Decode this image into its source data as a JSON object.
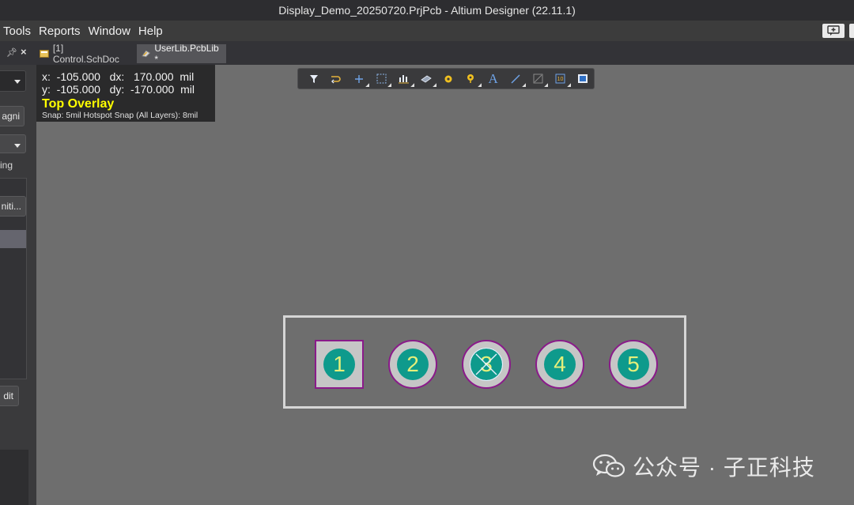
{
  "window": {
    "title": "Display_Demo_20250720.PrjPcb - Altium Designer (22.11.1)"
  },
  "menubar": {
    "items": [
      {
        "label": "Tools"
      },
      {
        "label": "Reports"
      },
      {
        "label": "Window"
      },
      {
        "label": "Help"
      }
    ]
  },
  "tabs": {
    "items": [
      {
        "label": "[1] Control.SchDoc"
      },
      {
        "label": "UserLib.PcbLib *"
      }
    ]
  },
  "left_panel": {
    "button1_label": "agni",
    "text1": "ing",
    "button2_label": "niti...",
    "button3_label": "dit"
  },
  "hud": {
    "row1": "x:  -105.000   dx:   170.000  mil",
    "row2": "y:  -105.000   dy:  -170.000  mil",
    "layer": "Top Overlay",
    "snap": "Snap: 5mil Hotspot Snap (All Layers): 8mil"
  },
  "toolbar": {
    "icons": [
      "filter-icon",
      "route-icon",
      "add-icon",
      "select-rect-icon",
      "align-icon",
      "component-icon",
      "via-icon",
      "pad-icon",
      "text-icon",
      "line-icon",
      "dimension-icon",
      "region-icon",
      "board-icon"
    ]
  },
  "footprint": {
    "pads": [
      {
        "label": "1"
      },
      {
        "label": "2"
      },
      {
        "label": "3"
      },
      {
        "label": "4"
      },
      {
        "label": "5"
      }
    ]
  },
  "watermark": {
    "text": "公众号 · 子正科技"
  }
}
